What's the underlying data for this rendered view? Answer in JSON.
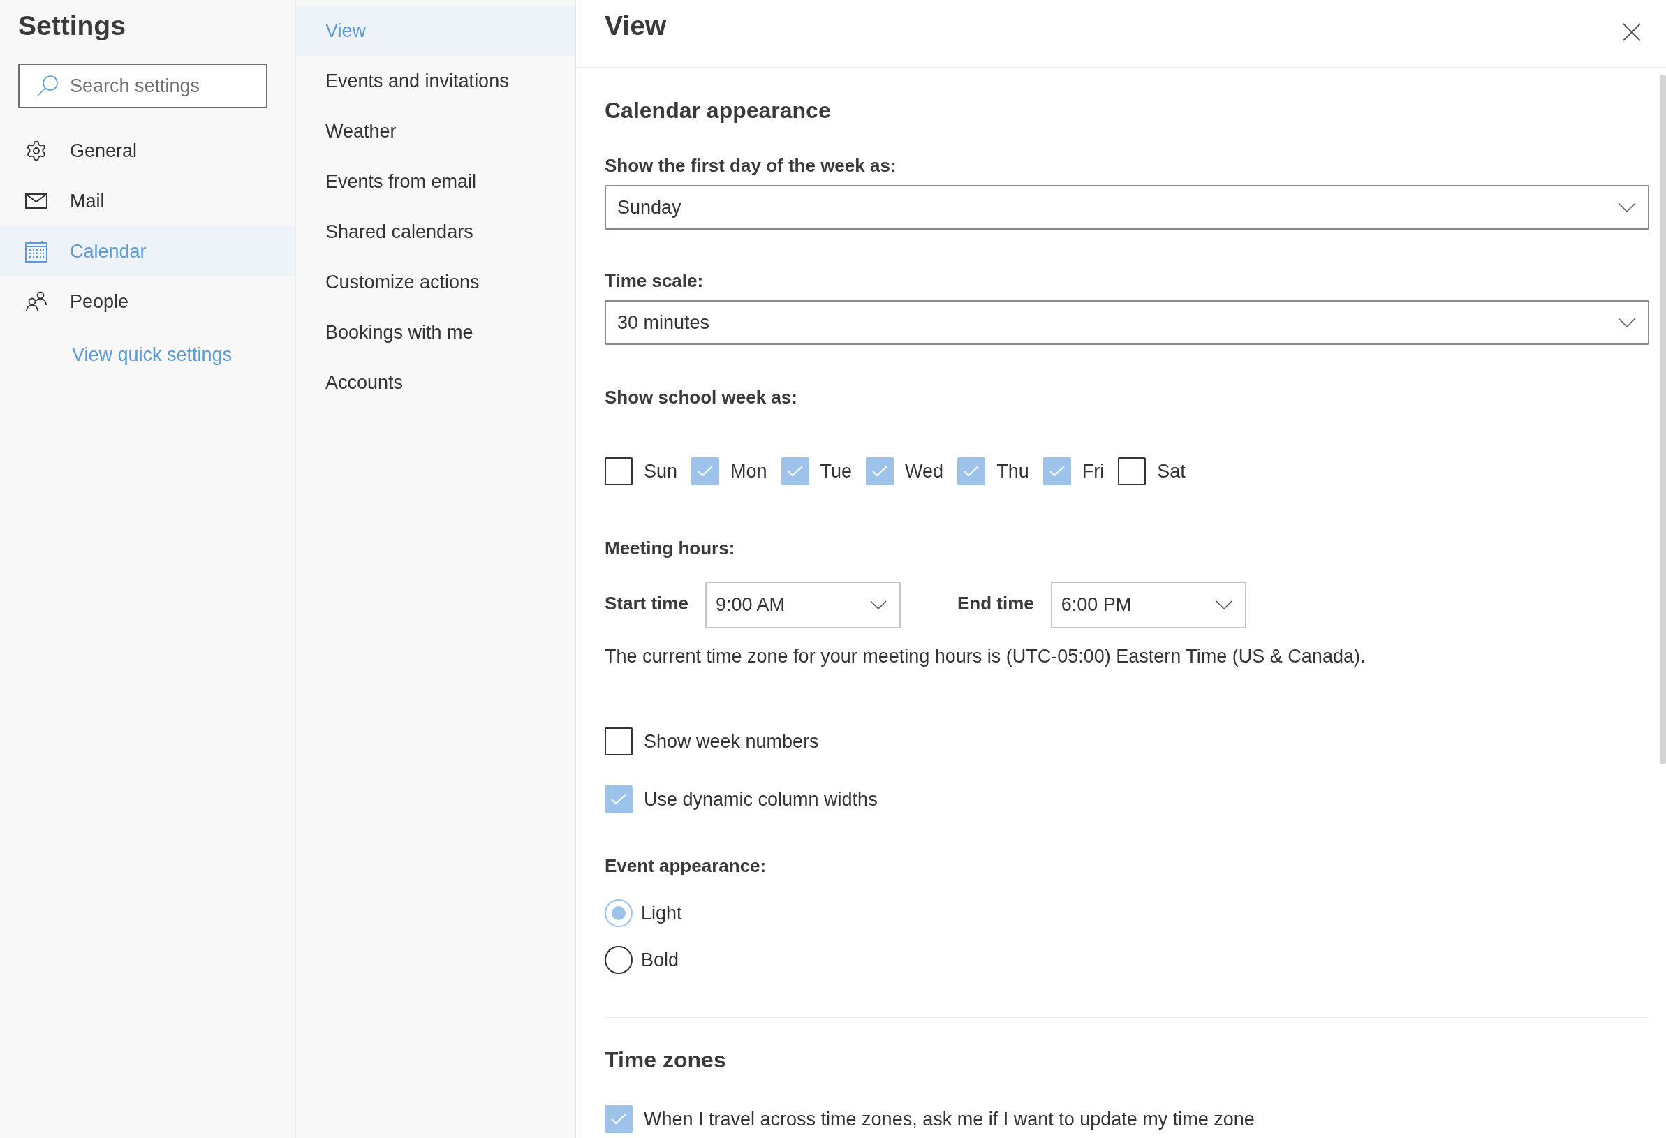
{
  "sidebar": {
    "title": "Settings",
    "search": {
      "placeholder": "Search settings"
    },
    "items": [
      {
        "label": "General",
        "selected": false
      },
      {
        "label": "Mail",
        "selected": false
      },
      {
        "label": "Calendar",
        "selected": true
      },
      {
        "label": "People",
        "selected": false
      }
    ],
    "link": "View quick settings"
  },
  "subnav": {
    "items": [
      {
        "label": "View",
        "selected": true
      },
      {
        "label": "Events and invitations",
        "selected": false
      },
      {
        "label": "Weather",
        "selected": false
      },
      {
        "label": "Events from email",
        "selected": false
      },
      {
        "label": "Shared calendars",
        "selected": false
      },
      {
        "label": "Customize actions",
        "selected": false
      },
      {
        "label": "Bookings with me",
        "selected": false
      },
      {
        "label": "Accounts",
        "selected": false
      }
    ]
  },
  "panel": {
    "title": "View",
    "calendar_appearance": {
      "heading": "Calendar appearance",
      "first_day": {
        "label": "Show the first day of the week as:",
        "value": "Sunday"
      },
      "time_scale": {
        "label": "Time scale:",
        "value": "30 minutes"
      },
      "school_week": {
        "label": "Show school week as:",
        "days": [
          {
            "label": "Sun",
            "checked": false
          },
          {
            "label": "Mon",
            "checked": true
          },
          {
            "label": "Tue",
            "checked": true
          },
          {
            "label": "Wed",
            "checked": true
          },
          {
            "label": "Thu",
            "checked": true
          },
          {
            "label": "Fri",
            "checked": true
          },
          {
            "label": "Sat",
            "checked": false
          }
        ]
      },
      "meeting_hours": {
        "label": "Meeting hours:",
        "start": {
          "label": "Start time",
          "value": "9:00 AM"
        },
        "end": {
          "label": "End time",
          "value": "6:00 PM"
        },
        "note": "The current time zone for your meeting hours is (UTC-05:00) Eastern Time (US & Canada)."
      },
      "options": [
        {
          "label": "Show week numbers",
          "checked": false
        },
        {
          "label": "Use dynamic column widths",
          "checked": true
        }
      ],
      "event_appearance": {
        "label": "Event appearance:",
        "choices": [
          {
            "label": "Light",
            "selected": true
          },
          {
            "label": "Bold",
            "selected": false
          }
        ]
      }
    },
    "time_zones": {
      "heading": "Time zones",
      "options": [
        {
          "label": "When I travel across time zones, ask me if I want to update my time zone",
          "checked": true
        }
      ]
    }
  }
}
